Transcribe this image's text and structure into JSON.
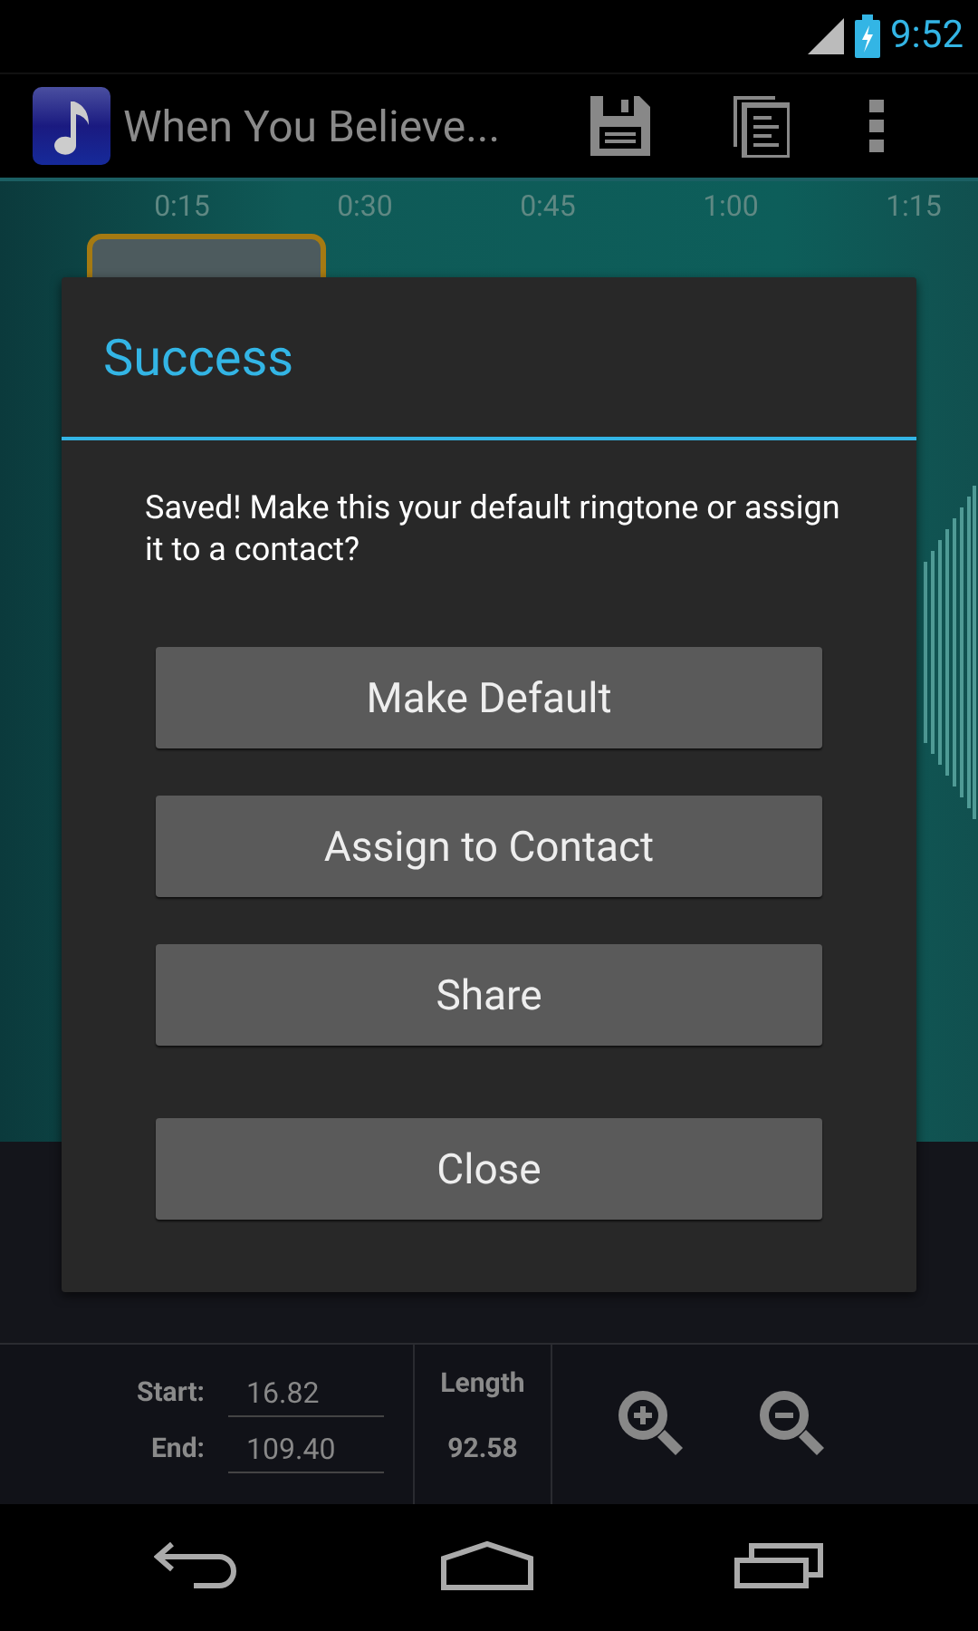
{
  "status_bar": {
    "time": "9:52"
  },
  "action_bar": {
    "title": "When You Believe..."
  },
  "timeline": {
    "ticks": [
      "0:15",
      "0:30",
      "0:45",
      "1:00",
      "1:15"
    ]
  },
  "dialog": {
    "title": "Success",
    "message": "Saved! Make this your default ringtone or assign it to a contact?",
    "buttons": [
      "Make Default",
      "Assign to Contact",
      "Share",
      "Close"
    ]
  },
  "controls": {
    "start_label": "Start:",
    "start_value": "16.82",
    "end_label": "End:",
    "end_value": "109.40",
    "length_label": "Length",
    "length_value": "92.58"
  }
}
